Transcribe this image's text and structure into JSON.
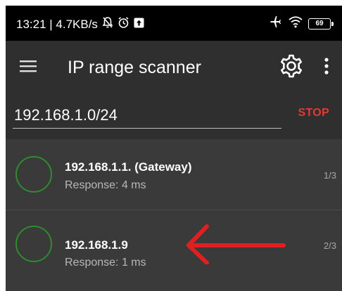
{
  "status_bar": {
    "time_speed": "13:21 | 4.7KB/s",
    "icons": [
      "muted-bell-icon",
      "alarm-clock-icon",
      "upload-notification-icon",
      "airplane-mode-icon",
      "wifi-icon",
      "battery-icon"
    ],
    "battery_level": "69"
  },
  "app_bar": {
    "title": "IP range scanner",
    "icons": [
      "hamburger-menu-icon",
      "gear-icon",
      "more-vert-icon"
    ]
  },
  "scan": {
    "range_value": "192.168.1.0/24",
    "stop_label": "STOP"
  },
  "results": [
    {
      "name": "192.168.1.1. (Gateway)",
      "response": "Response: 4 ms",
      "counter": "1/3",
      "status_color": "#2e8b2e"
    },
    {
      "name": "192.168.1.9",
      "response": "Response: 1 ms",
      "counter": "2/3",
      "status_color": "#2e8b2e"
    }
  ],
  "annotation": {
    "arrow_color": "#e02020"
  }
}
